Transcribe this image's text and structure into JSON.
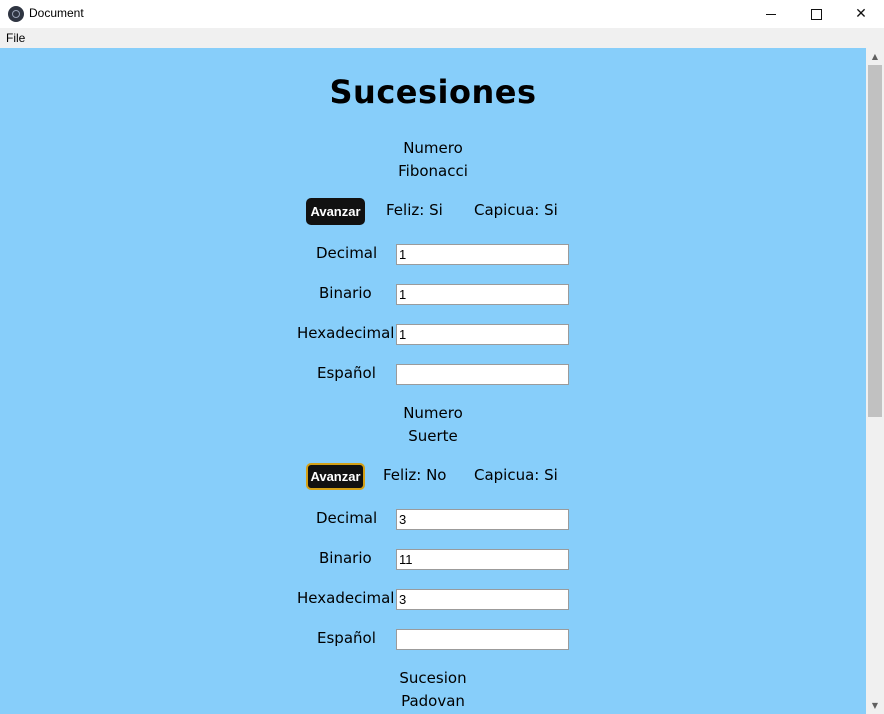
{
  "window": {
    "title": "Document",
    "minimize": "—",
    "maximize": "☐",
    "close": "✕"
  },
  "menu": {
    "file": "File"
  },
  "page": {
    "title": "Sucesiones"
  },
  "sections": [
    {
      "heading_line1": "Numero",
      "heading_line2": "Fibonacci",
      "button": "Avanzar",
      "feliz": "Feliz: Si",
      "capicua": "Capicua: Si",
      "fields": {
        "decimal_label": "Decimal",
        "decimal_value": "1",
        "binario_label": "Binario",
        "binario_value": "1",
        "hexadecimal_label": "Hexadecimal",
        "hexadecimal_value": "1",
        "espanol_label": "Español",
        "espanol_value": ""
      }
    },
    {
      "heading_line1": "Numero",
      "heading_line2": "Suerte",
      "button": "Avanzar",
      "feliz": "Feliz: No",
      "capicua": "Capicua: Si",
      "fields": {
        "decimal_label": "Decimal",
        "decimal_value": "3",
        "binario_label": "Binario",
        "binario_value": "11",
        "hexadecimal_label": "Hexadecimal",
        "hexadecimal_value": "3",
        "espanol_label": "Español",
        "espanol_value": ""
      }
    },
    {
      "heading_line1": "Sucesion",
      "heading_line2": "Padovan"
    }
  ],
  "colors": {
    "background": "#87cefa",
    "button": "#111111",
    "button_focus_border": "#d4a016"
  }
}
